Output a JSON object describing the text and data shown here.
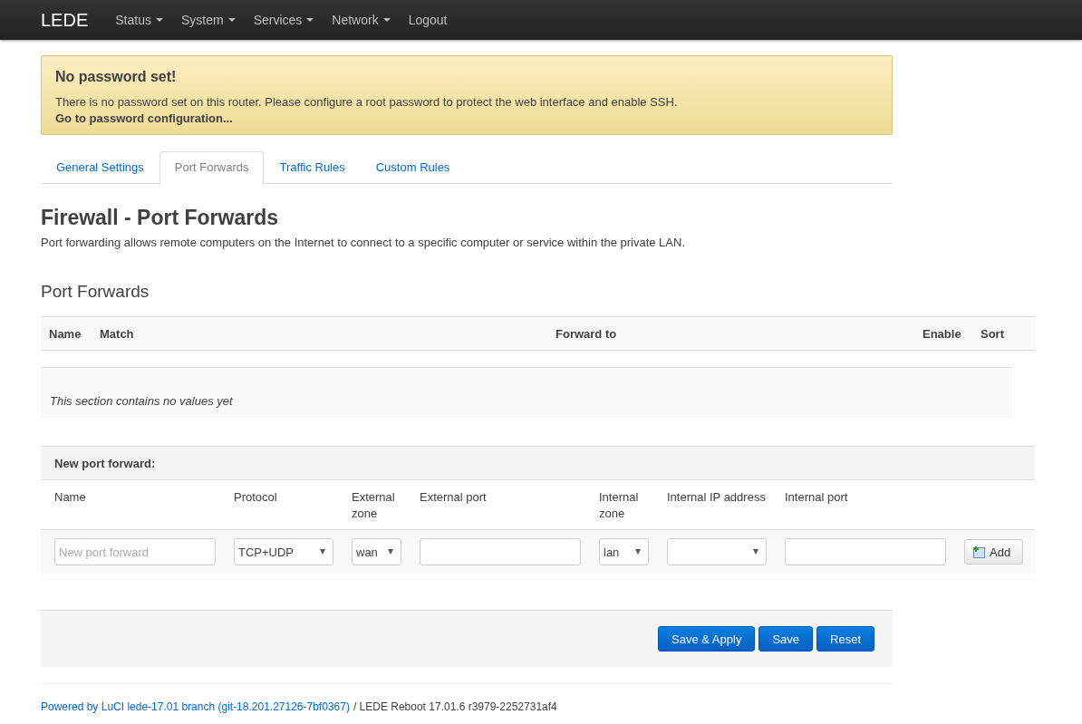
{
  "navbar": {
    "brand": "LEDE",
    "menu": [
      {
        "label": "Status",
        "dropdown": true
      },
      {
        "label": "System",
        "dropdown": true
      },
      {
        "label": "Services",
        "dropdown": true
      },
      {
        "label": "Network",
        "dropdown": true
      },
      {
        "label": "Logout",
        "dropdown": false
      }
    ]
  },
  "alert": {
    "title": "No password set!",
    "message": "There is no password set on this router. Please configure a root password to protect the web interface and enable SSH.",
    "link": "Go to password configuration..."
  },
  "tabs": [
    {
      "label": "General Settings",
      "selected": false
    },
    {
      "label": "Port Forwards",
      "selected": true
    },
    {
      "label": "Traffic Rules",
      "selected": false
    },
    {
      "label": "Custom Rules",
      "selected": false
    }
  ],
  "page": {
    "title": "Firewall - Port Forwards",
    "description": "Port forwarding allows remote computers on the Internet to connect to a specific computer or service within the private LAN."
  },
  "section": {
    "title": "Port Forwards",
    "columns": [
      "Name",
      "Match",
      "Forward to",
      "Enable",
      "Sort"
    ],
    "empty_text": "This section contains no values yet"
  },
  "new_forward": {
    "title": "New port forward:",
    "fields": [
      {
        "label": "Name",
        "kind": "text",
        "placeholder": "New port forward"
      },
      {
        "label": "Protocol",
        "kind": "select",
        "value": "TCP+UDP"
      },
      {
        "label": "External zone",
        "kind": "select",
        "value": "wan"
      },
      {
        "label": "External port",
        "kind": "text"
      },
      {
        "label": "Internal zone",
        "kind": "select",
        "value": "lan"
      },
      {
        "label": "Internal IP address",
        "kind": "select"
      },
      {
        "label": "Internal port",
        "kind": "text"
      }
    ],
    "add_button": "Add"
  },
  "actions": [
    "Save & Apply",
    "Save",
    "Reset"
  ],
  "footer": {
    "link": "Powered by LuCI lede-17.01 branch (git-18.201.27126-7bf0367)",
    "text": "/ LEDE Reboot 17.01.6 r3979-2252731af4"
  }
}
